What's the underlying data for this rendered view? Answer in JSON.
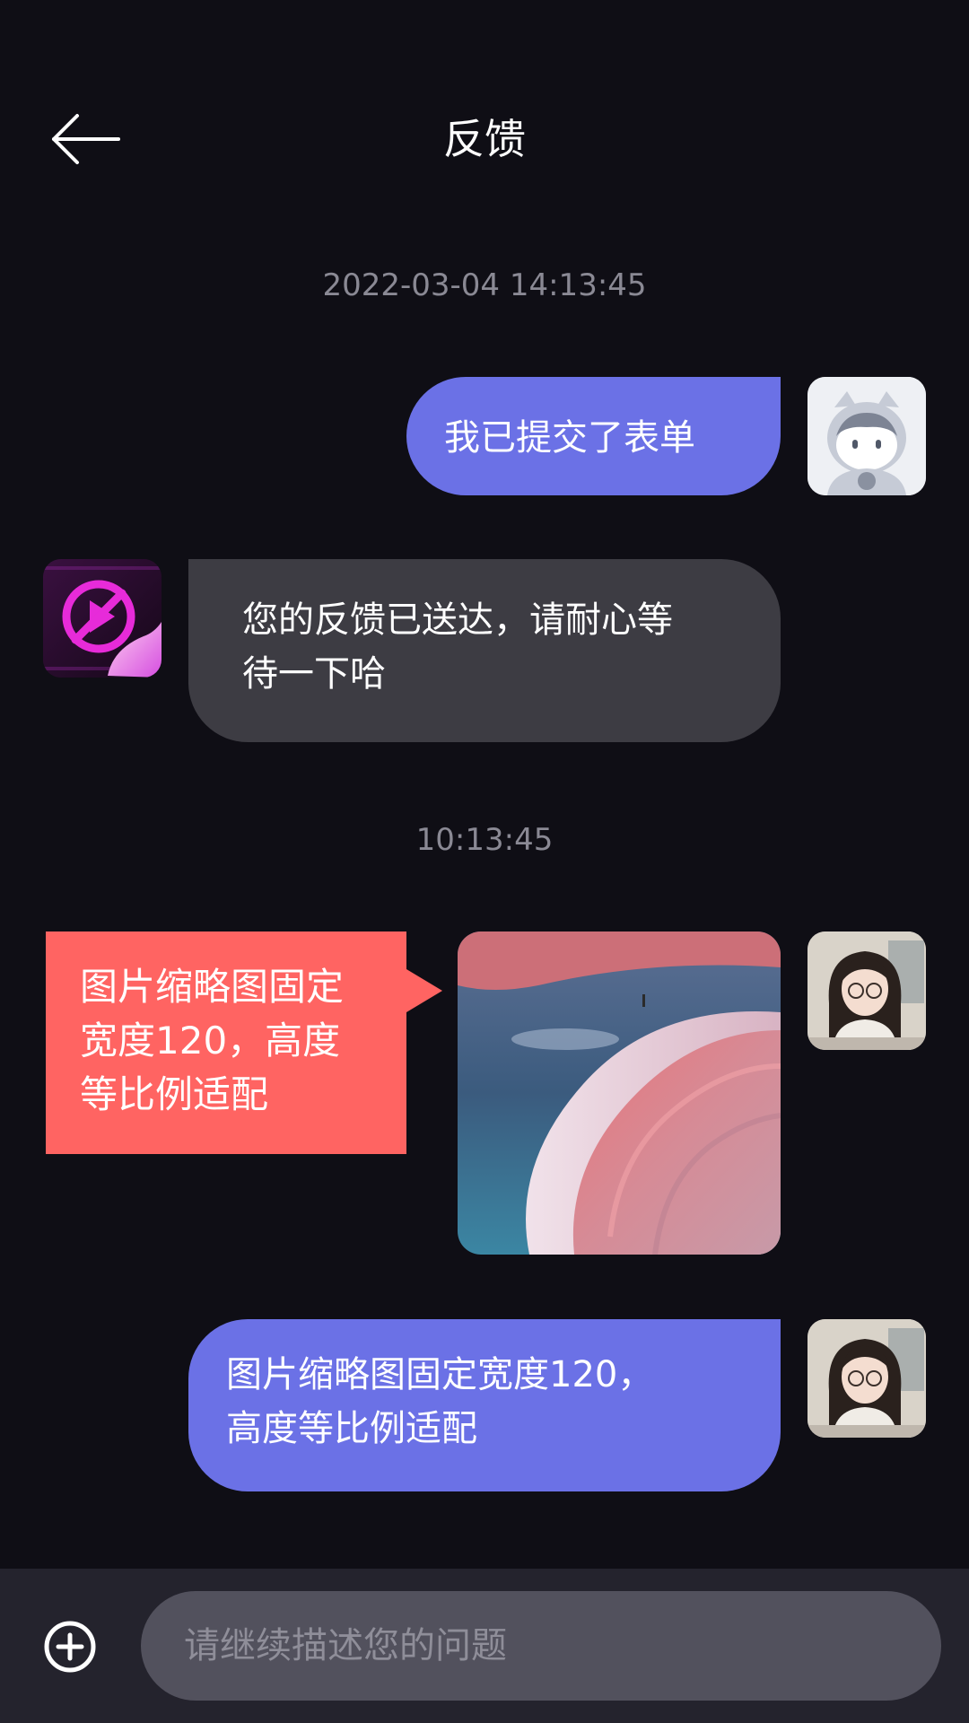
{
  "header": {
    "title": "反馈",
    "back_icon": "arrow-left-icon"
  },
  "timestamps": {
    "first": "2022-03-04 14:13:45",
    "second": "10:13:45"
  },
  "messages": [
    {
      "direction": "outgoing",
      "text": "我已提交了表单"
    },
    {
      "direction": "incoming",
      "text_line1": "您的反馈已送达，请耐心等",
      "text_line2": "待一下哈"
    },
    {
      "direction": "outgoing",
      "type": "image"
    },
    {
      "direction": "outgoing",
      "text_line1": "图片缩略图固定宽度120，",
      "text_line2": "高度等比例适配"
    }
  ],
  "annotation": {
    "line1": "图片缩略图固定",
    "line2": "宽度120，高度",
    "line3": "等比例适配"
  },
  "input": {
    "placeholder": "请继续描述您的问题",
    "add_icon": "plus-circle-icon"
  },
  "colors": {
    "background": "#0f0e15",
    "outgoing_bubble": "#6b71e6",
    "incoming_bubble": "#3d3c43",
    "annotation": "#ff6462",
    "input_bar": "#24232d",
    "input_field": "#52515d"
  }
}
